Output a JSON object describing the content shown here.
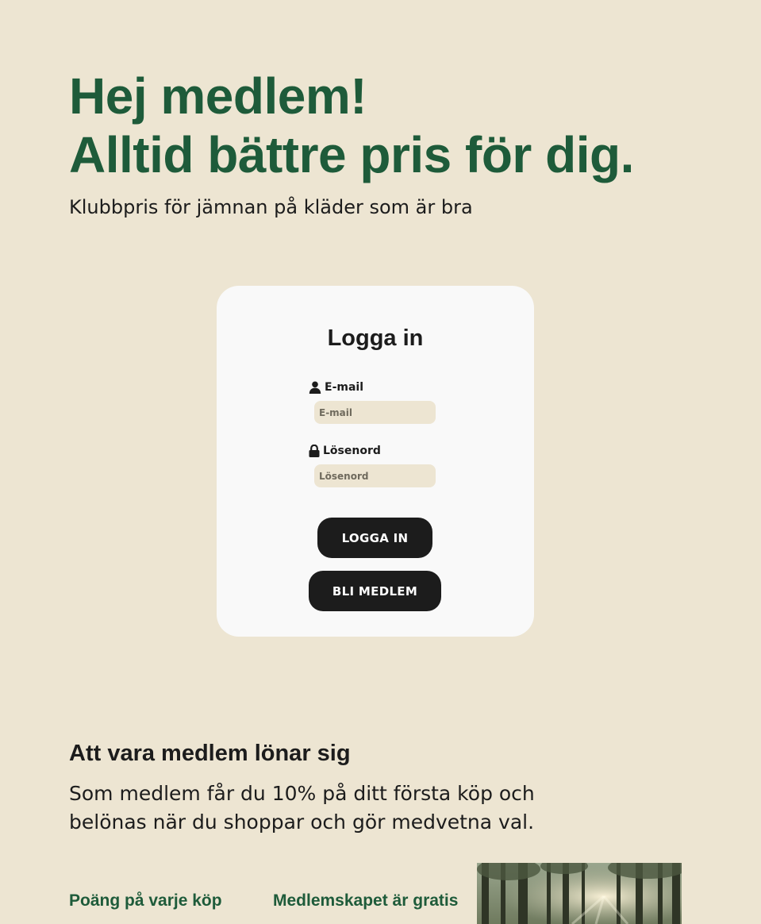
{
  "hero": {
    "title_line1": "Hej medlem!",
    "title_line2": "Alltid bättre pris för dig.",
    "subtitle": "Klubbpris för jämnan på kläder som är bra"
  },
  "login": {
    "title": "Logga in",
    "email_label": "E-mail",
    "email_placeholder": "E-mail",
    "email_value": "",
    "password_label": "Lösenord",
    "password_placeholder": "Lösenord",
    "password_value": "",
    "login_button": "LOGGA IN",
    "join_button": "BLI MEDLEM",
    "email_icon": "user-icon",
    "password_icon": "lock-icon"
  },
  "benefits": {
    "title": "Att vara medlem lönar sig",
    "text": "Som medlem får du 10% på ditt första köp och belönas när du shoppar och gör medvetna val.",
    "perks": [
      "Poäng på varje köp",
      "Medlemskapet är gratis"
    ]
  },
  "colors": {
    "background": "#ede5d2",
    "brand_green": "#1e5b3a",
    "card": "#f9f9f9",
    "button": "#1c1c1c"
  }
}
